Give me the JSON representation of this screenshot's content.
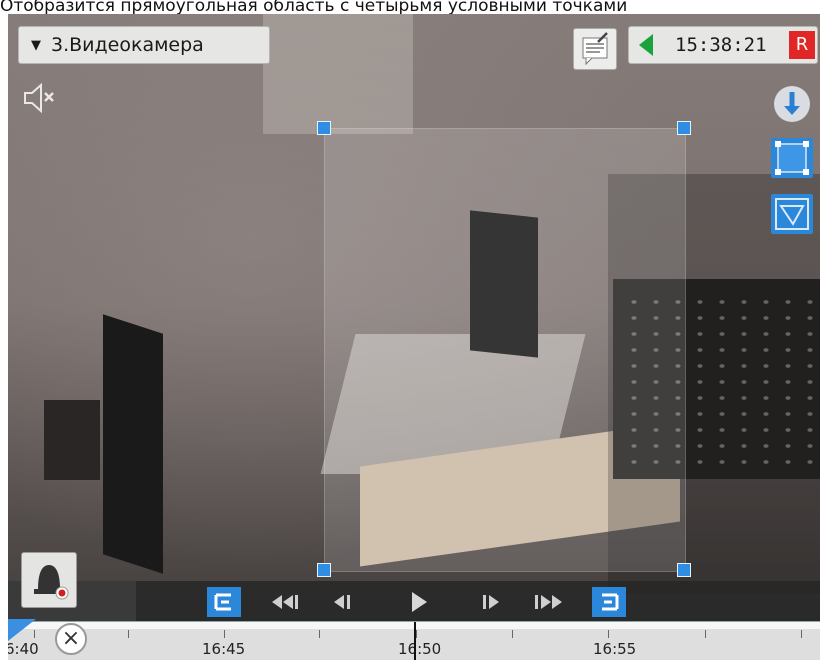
{
  "caption": "Отобразится прямоугольная область с четырьмя условными точками",
  "camera": {
    "selector_label": "3.Видеокамера"
  },
  "status": {
    "time": "15:38:21",
    "record_badge": "R"
  },
  "timeline": {
    "labels": [
      "6:40",
      "16:45",
      "16:50",
      "16:55"
    ]
  },
  "colors": {
    "accent": "#2f8de4",
    "record": "#e02626",
    "play_indicator": "#1aa33a"
  },
  "icons": [
    "dropdown-icon",
    "mute-icon",
    "notes-icon",
    "play-indicator-icon",
    "download-icon",
    "rect-area-icon",
    "polygon-area-icon",
    "alarm-bell-icon",
    "close-icon"
  ]
}
